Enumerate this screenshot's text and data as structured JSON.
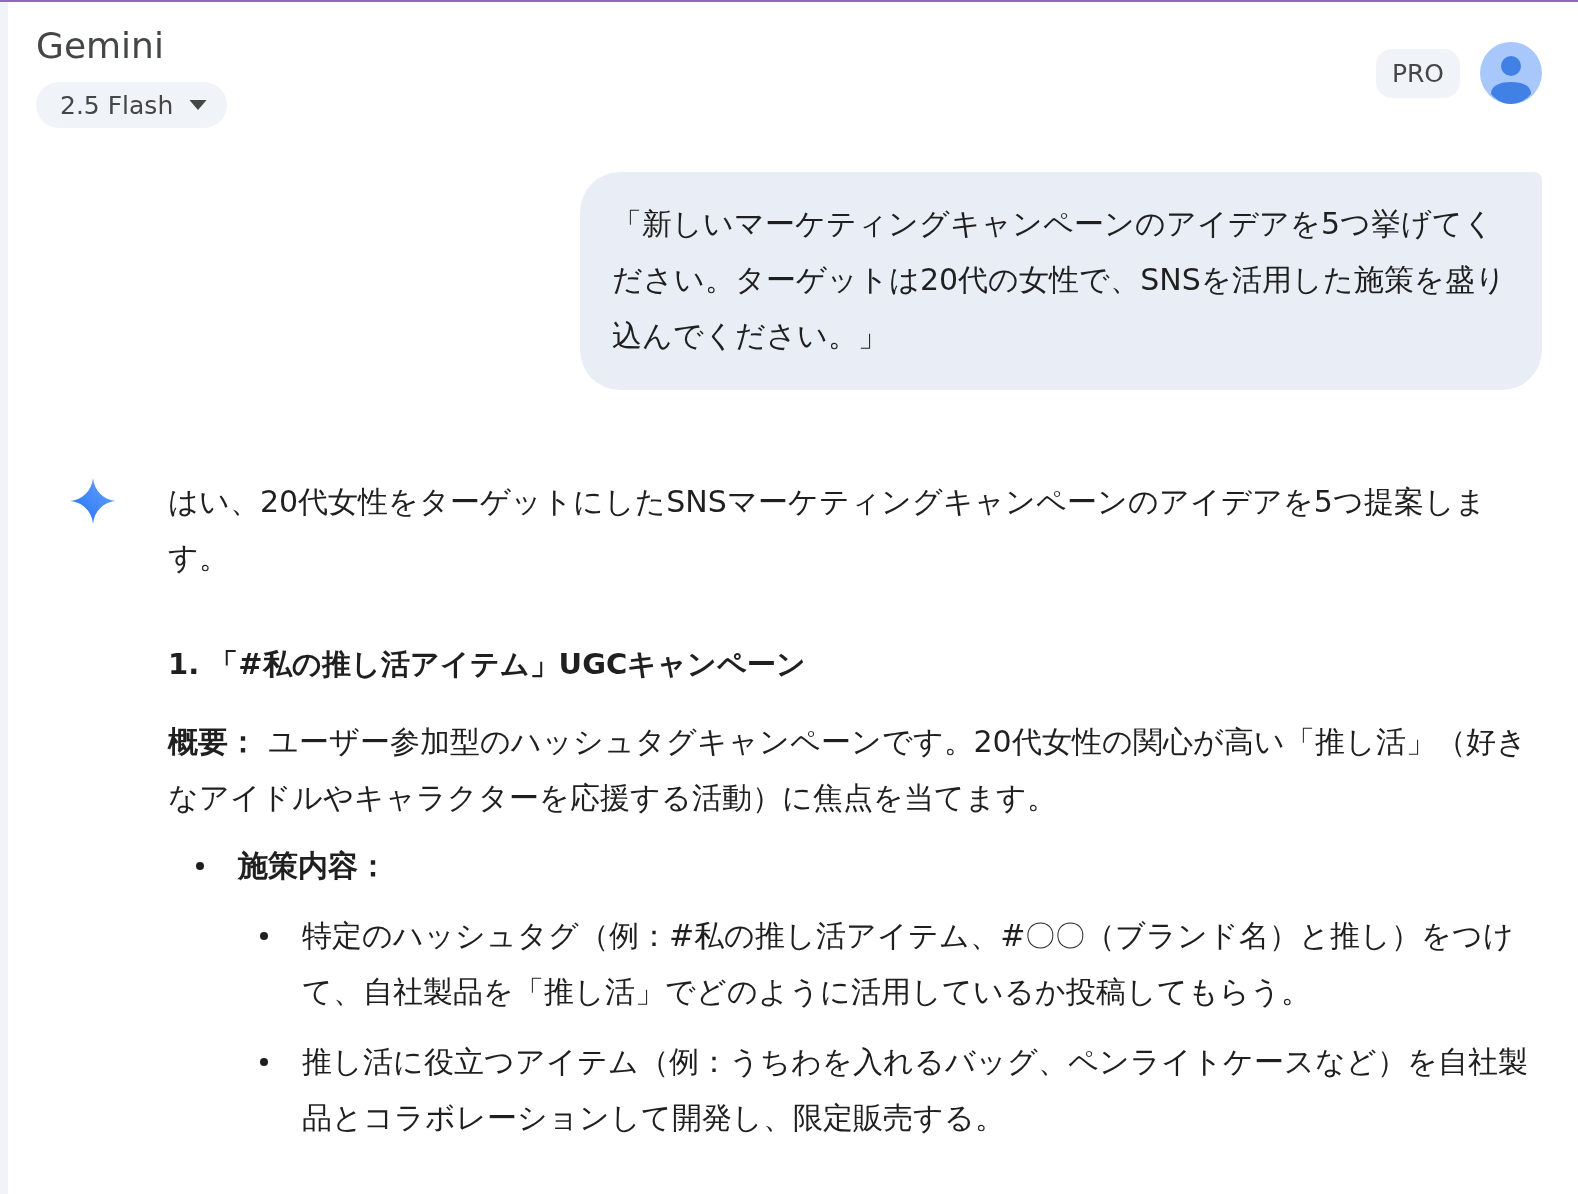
{
  "header": {
    "title": "Gemini",
    "model_selector": {
      "label": "2.5 Flash"
    },
    "plan_badge": "PRO"
  },
  "user_message": {
    "text": "「新しいマーケティングキャンペーンのアイデアを5つ挙げてください。ターゲットは20代の女性で、SNSを活用した施策を盛り込んでください。」"
  },
  "response": {
    "intro": "はい、20代女性をターゲットにしたSNSマーケティングキャンペーンのアイデアを5つ提案します。",
    "sections": [
      {
        "heading": "1. 「#私の推し活アイテム」UGCキャンペーン",
        "summary": "**概要：** ユーザー参加型のハッシュタグキャンペーンです。20代女性の関心が高い「推し活」（好きなアイドルやキャラクターを応援する活動）に焦点を当てます。",
        "bullets": [
          {
            "text": "施策内容：",
            "children": [
              {
                "text": "特定のハッシュタグ（例：#私の推し活アイテム、#〇〇（ブランド名）と推し）をつけて、自社製品を「推し活」でどのように活用しているか投稿してもらう。"
              },
              {
                "text": "推し活に役立つアイテム（例：うちわを入れるバッグ、ペンライトケースなど）を自社製品とコラボレーションして開発し、限定販売する。"
              }
            ]
          }
        ]
      }
    ]
  }
}
